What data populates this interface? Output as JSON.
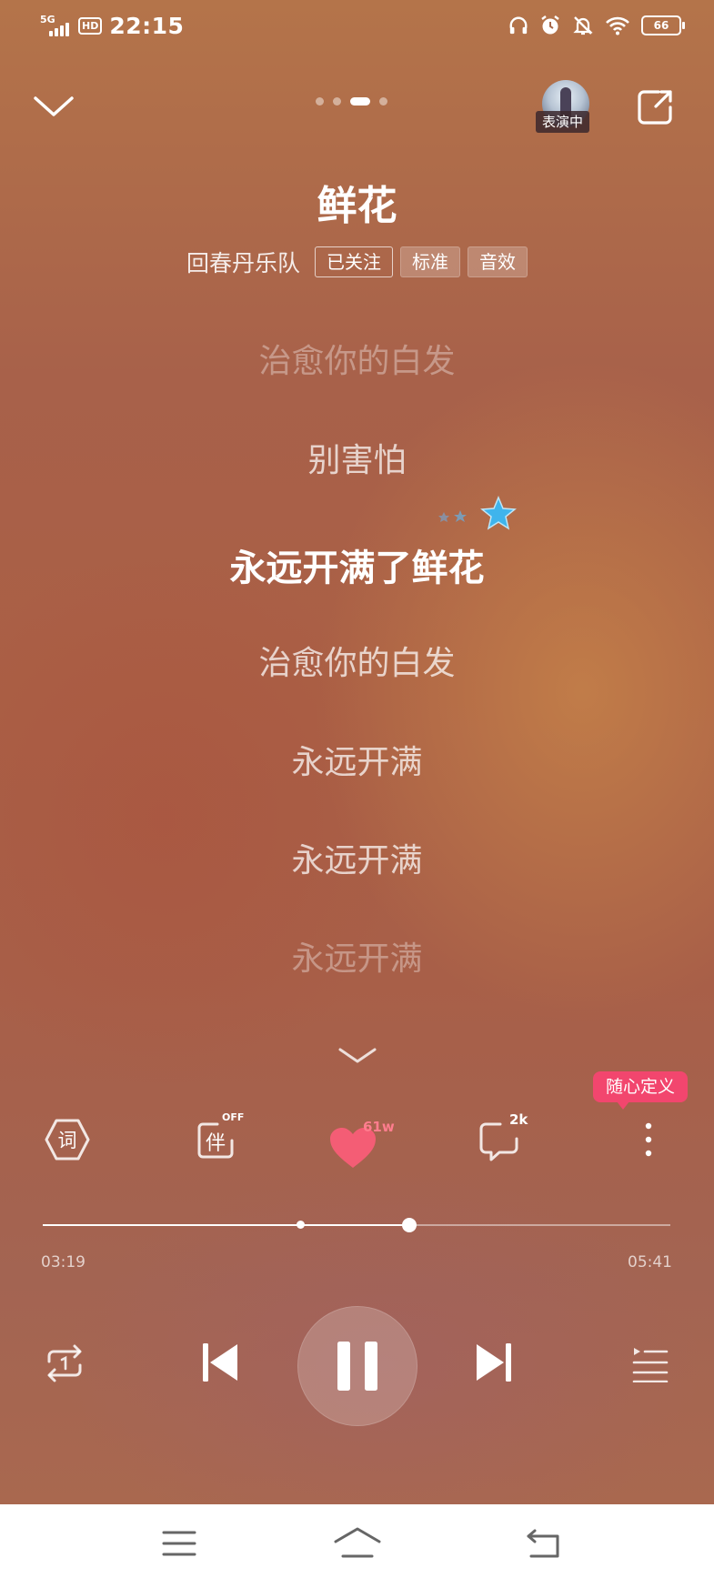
{
  "status_bar": {
    "network": "5G",
    "hd": "HD",
    "time": "22:15",
    "battery": "66",
    "icons": [
      "headphones-icon",
      "alarm-icon",
      "silent-bell-icon",
      "wifi-icon",
      "battery-icon"
    ]
  },
  "top_bar": {
    "page_dots": 4,
    "active_dot": 2,
    "live_badge": "表演中"
  },
  "song": {
    "title": "鲜花",
    "artist": "回春丹乐队",
    "follow_tag": "已关注",
    "quality_tag": "标准",
    "effect_tag": "音效"
  },
  "lyrics": {
    "lines": [
      "治愈你的白发",
      "别害怕",
      "永远开满了鲜花",
      "治愈你的白发",
      "永远开满",
      "永远开满",
      "永远开满"
    ],
    "current_index": 2
  },
  "tooltip": "随心定义",
  "actions": {
    "lyric_label": "词",
    "accompany_label": "伴",
    "accompany_state": "OFF",
    "like_count": "61w",
    "comment_count": "2k"
  },
  "playback": {
    "current_time": "03:19",
    "total_time": "05:41",
    "progress": 0.584,
    "buffered": 0.41,
    "state": "playing"
  },
  "colors": {
    "accent_pink": "#f2466e",
    "heart": "#f45d75",
    "star_blue": "#3fb4ec"
  }
}
